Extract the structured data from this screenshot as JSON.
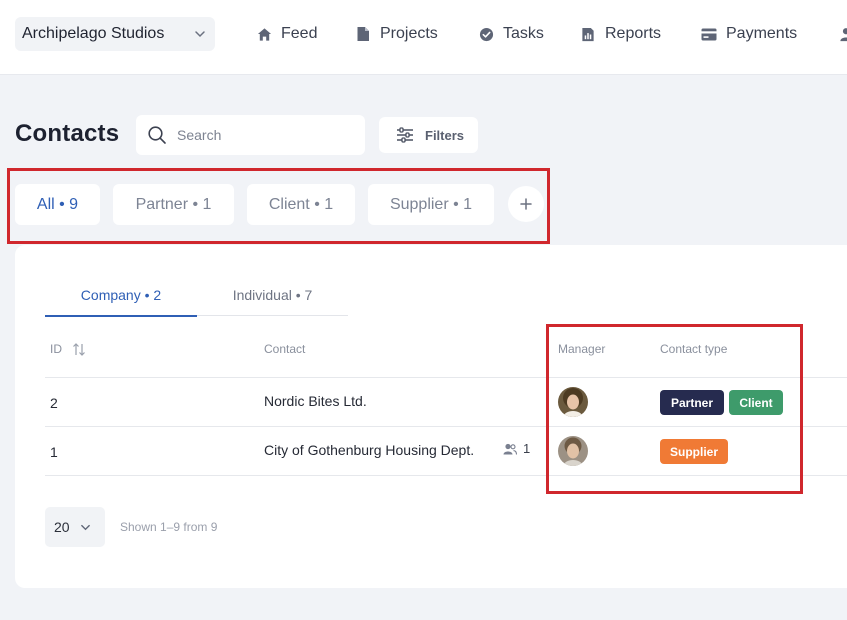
{
  "topbar": {
    "workspace": "Archipelago Studios",
    "nav": [
      {
        "label": "Feed",
        "icon": "home-icon"
      },
      {
        "label": "Projects",
        "icon": "document-icon"
      },
      {
        "label": "Tasks",
        "icon": "check-circle-icon"
      },
      {
        "label": "Reports",
        "icon": "bar-chart-icon"
      },
      {
        "label": "Payments",
        "icon": "credit-card-icon"
      }
    ]
  },
  "page": {
    "title": "Contacts",
    "search_placeholder": "Search",
    "filters_label": "Filters"
  },
  "segments": [
    {
      "label": "All • 9",
      "active": true
    },
    {
      "label": "Partner • 1",
      "active": false
    },
    {
      "label": "Client • 1",
      "active": false
    },
    {
      "label": "Supplier • 1",
      "active": false
    }
  ],
  "subtabs": [
    {
      "label": "Company • 2",
      "active": true
    },
    {
      "label": "Individual • 7",
      "active": false
    }
  ],
  "table": {
    "columns": {
      "id": "ID",
      "contact": "Contact",
      "manager": "Manager",
      "contact_type": "Contact type"
    },
    "rows": [
      {
        "id": "2",
        "contact": "Nordic Bites Ltd.",
        "people_count": "",
        "types": [
          "Partner",
          "Client"
        ]
      },
      {
        "id": "1",
        "contact": "City of Gothenburg Housing Dept.",
        "people_count": "1",
        "types": [
          "Supplier"
        ]
      }
    ]
  },
  "badge_colors": {
    "Partner": "#262b4f",
    "Client": "#3e9b6b",
    "Supplier": "#f07a35"
  },
  "footer": {
    "page_size": "20",
    "shown": "Shown 1–9 from 9"
  },
  "colors": {
    "accent": "#2f5fb5",
    "highlight": "#d0272d"
  }
}
